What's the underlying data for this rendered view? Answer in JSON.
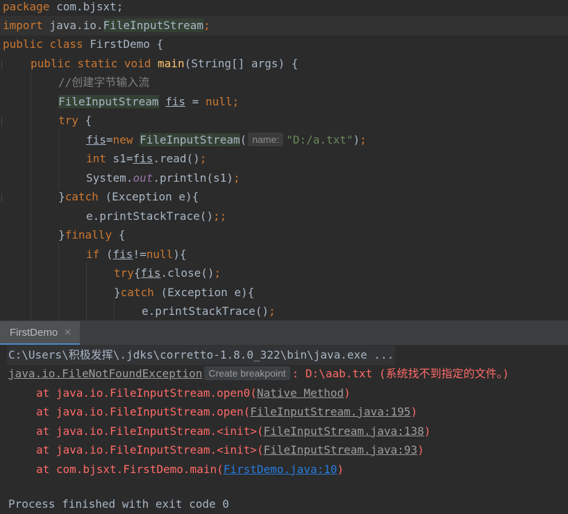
{
  "editor": {
    "line1": {
      "keyword": "package",
      "text": " com.bjsxt;"
    },
    "line2": {
      "keyword": "import",
      "pre": " java.io.",
      "cls": "FileInputStream",
      "semi": ";"
    },
    "line3": {
      "kw1": "public",
      "kw2": " class",
      "text": " FirstDemo {"
    },
    "line4": {
      "kw1": "public",
      "kw2": " static",
      "kw3": " void",
      "method": " main",
      "text": "(String[] args) {"
    },
    "line5": {
      "comment": "//创建字节输入流"
    },
    "line6": {
      "cls": "FileInputStream",
      "var": "fis",
      "eq": " = ",
      "null": "null",
      "semi": ";"
    },
    "line7": {
      "kw": "try",
      "text": " {"
    },
    "line8": {
      "var": "fis",
      "eq": "=",
      "new": "new",
      "cls": "FileInputStream",
      "paren": "(",
      "hint": "name:",
      "string": "\"D:/a.txt\"",
      "close": ")",
      "semi": ";"
    },
    "line9": {
      "kw": "int",
      "pre": " s1=",
      "var": "fis",
      "post": ".read()",
      "semi": ";"
    },
    "line10": {
      "pre": "System.",
      "field": "out",
      "post": ".println(s1)",
      "semi": ";"
    },
    "line11": {
      "brace": "}",
      "kw": "catch",
      "text": " (Exception e){"
    },
    "line12": {
      "text": "e.printStackTrace()",
      "semi": ";;"
    },
    "line13": {
      "brace": "}",
      "kw": "finally",
      "text": " {"
    },
    "line14": {
      "kw": "if",
      "pre": " (",
      "var": "fis",
      "op": "!=",
      "null": "null",
      "post": "){"
    },
    "line15": {
      "kw": "try",
      "brace": "{",
      "var": "fis",
      "post": ".close()",
      "semi": ";"
    },
    "line16": {
      "brace": "}",
      "kw": "catch",
      "text": " (Exception e){"
    },
    "line17": {
      "text": "e.printStackTrace()",
      "semi": ";"
    }
  },
  "run_panel": {
    "tab_label": "FirstDemo",
    "tab_close": "×",
    "console": {
      "cmd": "C:\\Users\\积极发挥\\.jdks\\corretto-1.8.0_322\\bin\\java.exe ...",
      "exception_class": "java.io.FileNotFoundException",
      "breakpoint_hint": "Create breakpoint",
      "exception_msg": ": D:\\aab.txt (系统找不到指定的文件。)",
      "trace": [
        {
          "prefix": "at java.io.FileInputStream.open0(",
          "link": "Native Method",
          "suffix": ")"
        },
        {
          "prefix": "at java.io.FileInputStream.open(",
          "link": "FileInputStream.java:195",
          "suffix": ")"
        },
        {
          "prefix": "at java.io.FileInputStream.<init>(",
          "link": "FileInputStream.java:138",
          "suffix": ")"
        },
        {
          "prefix": "at java.io.FileInputStream.<init>(",
          "link": "FileInputStream.java:93",
          "suffix": ")"
        },
        {
          "prefix": "at com.bjsxt.FirstDemo.main(",
          "link": "FirstDemo.java:10",
          "suffix": ")"
        }
      ],
      "exit_line": "Process finished with exit code 0"
    }
  },
  "colors": {
    "background": "#2b2b2b",
    "keyword": "#cc7832",
    "string": "#6a8759",
    "method": "#ffc66d",
    "error": "#ff6b68",
    "link": "#287bde"
  }
}
